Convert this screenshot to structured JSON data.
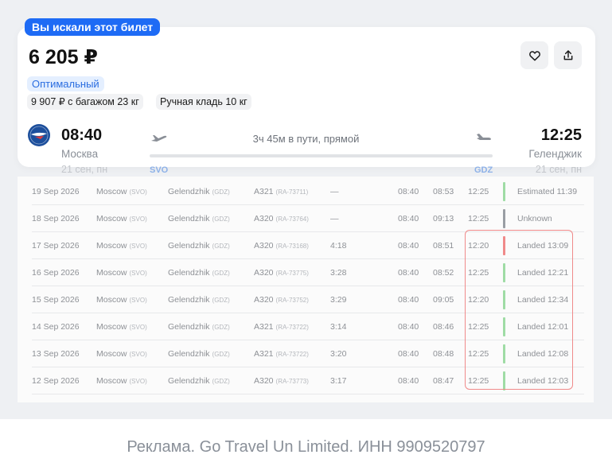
{
  "badge": "Вы искали этот билет",
  "price": "6 205 ₽",
  "tags": {
    "optimal": "Оптимальный",
    "baggage": "9 907 ₽ с багажом 23 кг",
    "hand_luggage": "Ручная кладь 10 кг"
  },
  "actions": {
    "favorite_icon": "heart-icon",
    "share_icon": "share-icon"
  },
  "flight": {
    "departure": {
      "time": "08:40",
      "city": "Москва",
      "date": "21 сен, пн",
      "airport": "SVO"
    },
    "arrival": {
      "time": "12:25",
      "city": "Геленджик",
      "date": "21 сен, пн",
      "airport": "GDZ"
    },
    "summary": "3ч 45м в пути, прямой"
  },
  "history": {
    "rows": [
      {
        "date": "19 Sep 2026",
        "from": "Moscow",
        "from_code": "(SVO)",
        "to": "Gelendzhik",
        "to_code": "(GDZ)",
        "plane": "A321",
        "reg": "(RA-73711)",
        "duration": "—",
        "dep": "08:40",
        "actual": "08:53",
        "arr": "12:25",
        "status": "Estimated 11:39",
        "bar_color": "#9fdca5"
      },
      {
        "date": "18 Sep 2026",
        "from": "Moscow",
        "from_code": "(SVO)",
        "to": "Gelendzhik",
        "to_code": "(GDZ)",
        "plane": "A320",
        "reg": "(RA-73764)",
        "duration": "—",
        "dep": "08:40",
        "actual": "09:13",
        "arr": "12:25",
        "status": "Unknown",
        "bar_color": "#9a9ea4"
      },
      {
        "date": "17 Sep 2026",
        "from": "Moscow",
        "from_code": "(SVO)",
        "to": "Gelendzhik",
        "to_code": "(GDZ)",
        "plane": "A320",
        "reg": "(RA-73168)",
        "duration": "4:18",
        "dep": "08:40",
        "actual": "08:51",
        "arr": "12:20",
        "status": "Landed 13:09",
        "bar_color": "#f08a8a"
      },
      {
        "date": "16 Sep 2026",
        "from": "Moscow",
        "from_code": "(SVO)",
        "to": "Gelendzhik",
        "to_code": "(GDZ)",
        "plane": "A320",
        "reg": "(RA-73775)",
        "duration": "3:28",
        "dep": "08:40",
        "actual": "08:52",
        "arr": "12:25",
        "status": "Landed 12:21",
        "bar_color": "#9fdca5"
      },
      {
        "date": "15 Sep 2026",
        "from": "Moscow",
        "from_code": "(SVO)",
        "to": "Gelendzhik",
        "to_code": "(GDZ)",
        "plane": "A320",
        "reg": "(RA-73752)",
        "duration": "3:29",
        "dep": "08:40",
        "actual": "09:05",
        "arr": "12:20",
        "status": "Landed 12:34",
        "bar_color": "#9fdca5"
      },
      {
        "date": "14 Sep 2026",
        "from": "Moscow",
        "from_code": "(SVO)",
        "to": "Gelendzhik",
        "to_code": "(GDZ)",
        "plane": "A321",
        "reg": "(RA-73722)",
        "duration": "3:14",
        "dep": "08:40",
        "actual": "08:46",
        "arr": "12:25",
        "status": "Landed 12:01",
        "bar_color": "#9fdca5"
      },
      {
        "date": "13 Sep 2026",
        "from": "Moscow",
        "from_code": "(SVO)",
        "to": "Gelendzhik",
        "to_code": "(GDZ)",
        "plane": "A321",
        "reg": "(RA-73722)",
        "duration": "3:20",
        "dep": "08:40",
        "actual": "08:48",
        "arr": "12:25",
        "status": "Landed 12:08",
        "bar_color": "#9fdca5"
      },
      {
        "date": "12 Sep 2026",
        "from": "Moscow",
        "from_code": "(SVO)",
        "to": "Gelendzhik",
        "to_code": "(GDZ)",
        "plane": "A320",
        "reg": "(RA-73773)",
        "duration": "3:17",
        "dep": "08:40",
        "actual": "08:47",
        "arr": "12:25",
        "status": "Landed 12:03",
        "bar_color": "#9fdca5"
      }
    ]
  },
  "footer": "Реклама. Go Travel Un Limited. ИНН 9909520797"
}
